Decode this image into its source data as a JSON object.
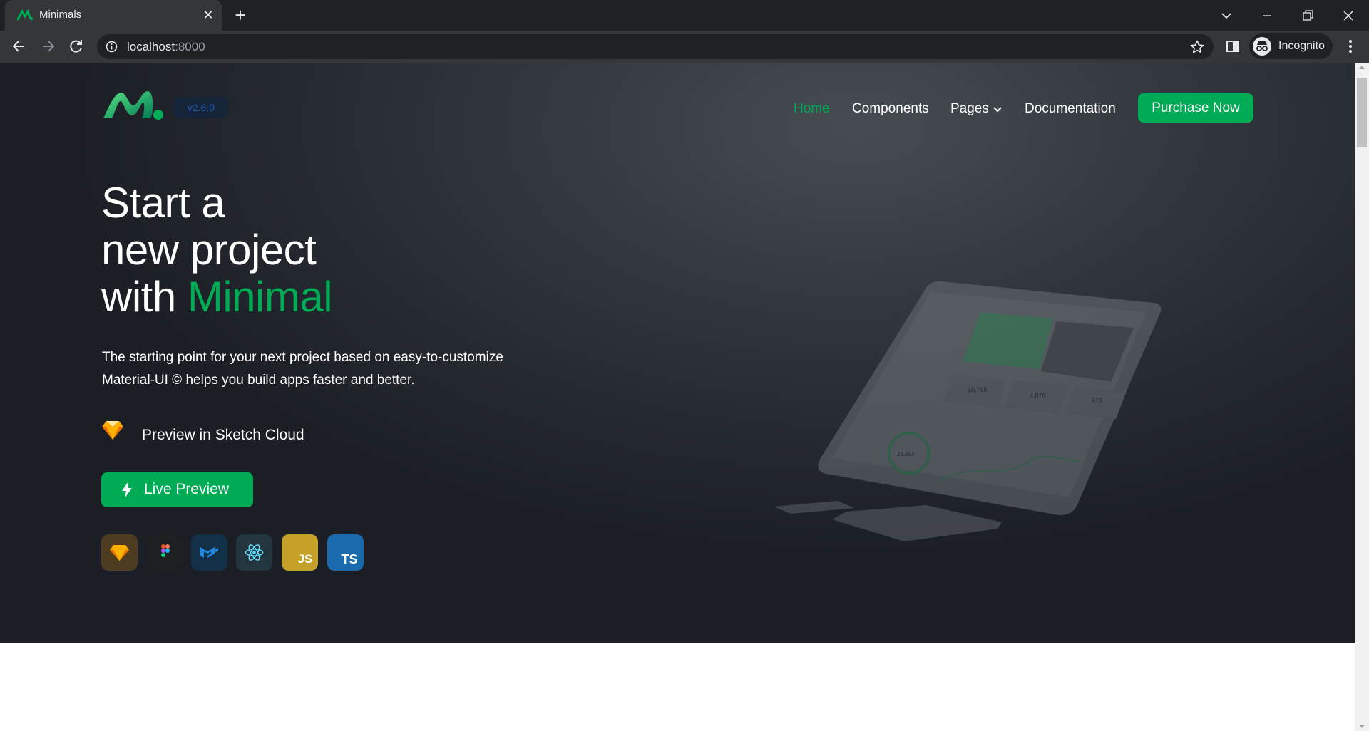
{
  "browser": {
    "tab_title": "Minimals",
    "url_host": "localhost",
    "url_port": ":8000",
    "profile_label": "Incognito"
  },
  "site": {
    "version_badge": "v2.6.0",
    "nav": {
      "home": "Home",
      "components": "Components",
      "pages": "Pages",
      "documentation": "Documentation",
      "purchase": "Purchase Now"
    },
    "hero": {
      "line1": "Start a",
      "line2": "new project",
      "line3_prefix": "with ",
      "line3_accent": "Minimal",
      "description_line1": "The starting point for your next project based on easy-to-customize",
      "description_line2": "Material-UI © helps you build apps faster and better.",
      "sketch_link": "Preview in Sketch Cloud",
      "live_preview": "Live Preview"
    },
    "tech_icons": [
      "sketch-icon",
      "figma-icon",
      "material-ui-icon",
      "react-icon",
      "javascript-icon",
      "typescript-icon"
    ],
    "tech_labels": {
      "js": "JS",
      "ts": "TS"
    },
    "mockup_texts": {
      "stat1": "18,765",
      "stat2": "4,876",
      "stat3": "678",
      "donut": "23,594"
    }
  },
  "colors": {
    "brand_green": "#00ab55",
    "hero_dark": "#1b1f25",
    "chrome": "#202124"
  }
}
